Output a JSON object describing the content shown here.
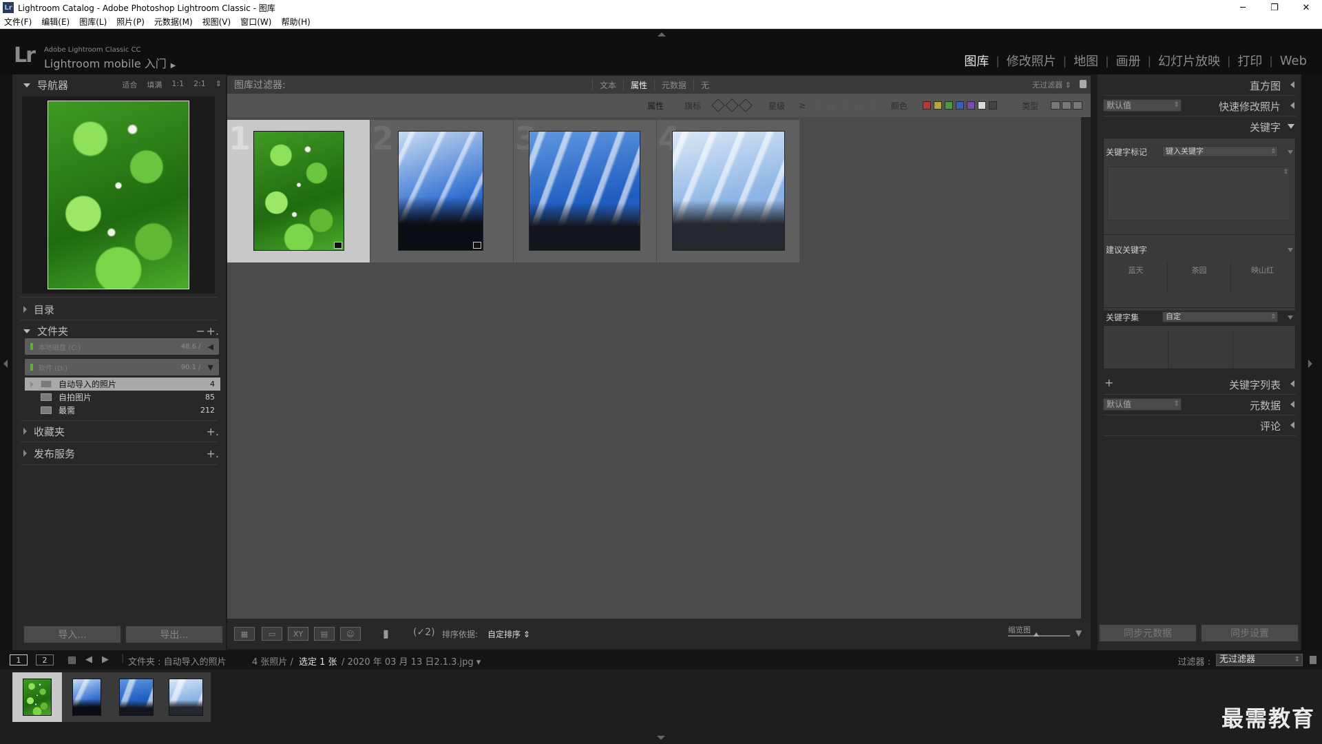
{
  "window": {
    "title": "Lightroom Catalog - Adobe Photoshop Lightroom Classic - 图库",
    "controls": {
      "minimize": "─",
      "maximize": "❐",
      "close": "✕"
    }
  },
  "menu": [
    "文件(F)",
    "编辑(E)",
    "图库(L)",
    "照片(P)",
    "元数据(M)",
    "视图(V)",
    "窗口(W)",
    "帮助(H)"
  ],
  "identity": {
    "logo": "Lr",
    "small": "Adobe Lightroom Classic CC",
    "big": "Lightroom mobile 入门",
    "arrow": "▶"
  },
  "modules": [
    "图库",
    "修改照片",
    "地图",
    "画册",
    "幻灯片放映",
    "打印",
    "Web"
  ],
  "active_module": "图库",
  "left": {
    "navigator": {
      "title": "导航器",
      "options": [
        "适合",
        "填满",
        "1:1",
        "2:1",
        "⇕"
      ]
    },
    "catalog": {
      "title": "目录"
    },
    "folders": {
      "title": "文件夹",
      "minus": "−",
      "plus": "+.",
      "volumes": [
        {
          "name": "本地磁盘 (C:)",
          "size": "48.6 /",
          "arrow": "◀"
        },
        {
          "name": "软件 (D:)",
          "size": "90.1 /",
          "arrow": "▼"
        }
      ],
      "items": [
        {
          "name": "自动导入的照片",
          "count": "4",
          "selected": true
        },
        {
          "name": "自拍图片",
          "count": "85",
          "selected": false
        },
        {
          "name": "最需",
          "count": "212",
          "selected": false
        }
      ]
    },
    "collections": {
      "title": "收藏夹",
      "plus": "+."
    },
    "publish": {
      "title": "发布服务",
      "plus": "+."
    },
    "import_label": "导入...",
    "export_label": "导出..."
  },
  "filter": {
    "title": "图库过滤器:",
    "tabs": [
      "文本",
      "属性",
      "元数据",
      "无"
    ],
    "active_tab": "属性",
    "preset": "无过滤器 ⇕",
    "attr_label": "属性",
    "flag_label": "旗标",
    "rating_label": "星级",
    "rating_op": "≥",
    "stars": [
      "☆",
      "☆",
      "☆",
      "☆",
      "☆"
    ],
    "color_label": "颜色",
    "colors": [
      "#b53a3a",
      "#b5a53a",
      "#4c9a3c",
      "#3a5fb5",
      "#7a4cb0",
      "#d8d8d8",
      "#444444"
    ],
    "kind_label": "类型"
  },
  "grid": {
    "cells": [
      {
        "index": "1",
        "selected": true
      },
      {
        "index": "2",
        "selected": false
      },
      {
        "index": "3",
        "selected": false
      },
      {
        "index": "4",
        "selected": false
      }
    ]
  },
  "toolbar": {
    "sort_label": "排序依据:",
    "sort_value": "自定排序 ⇕",
    "painter": "(✓2)",
    "thumb_label": "缩览图",
    "grid_icon": "▦",
    "loupe_icon": "▭",
    "compare_icon": "XY",
    "survey_icon": "▤",
    "people_icon": "☺",
    "spray_icon": "▮",
    "thumb_size_fraction": 0.45
  },
  "right": {
    "histogram": "直方图",
    "quick_develop": {
      "title": "快速修改照片",
      "preset": "默认值"
    },
    "keywording": {
      "title": "关键字",
      "tags_label": "关键字标记",
      "tags_value": "键入关键字",
      "suggested_label": "建议关键字",
      "suggested": [
        "蓝天",
        "茶园",
        "映山红"
      ],
      "set_label": "关键字集",
      "set_value": "自定"
    },
    "keyword_list": {
      "title": "关键字列表",
      "plus": "+"
    },
    "metadata": {
      "title": "元数据",
      "preset": "默认值"
    },
    "comments": "评论",
    "sync_metadata": "同步元数据",
    "sync_settings": "同步设置"
  },
  "filmstrip_bar": {
    "page1": "1",
    "page2": "2",
    "source_prefix": "文件夹 : 自动导入的照片",
    "count": "4 张照片 /",
    "selected": "选定 1 张",
    "file": "/ 2020 年 03 月 13 日2.1.3.jpg ▾",
    "filter_label": "过滤器 :",
    "filter_value": "无过滤器",
    "grid_icon": "▦",
    "back_icon": "◀",
    "forward_icon": "▶"
  },
  "watermark": "最需教育"
}
